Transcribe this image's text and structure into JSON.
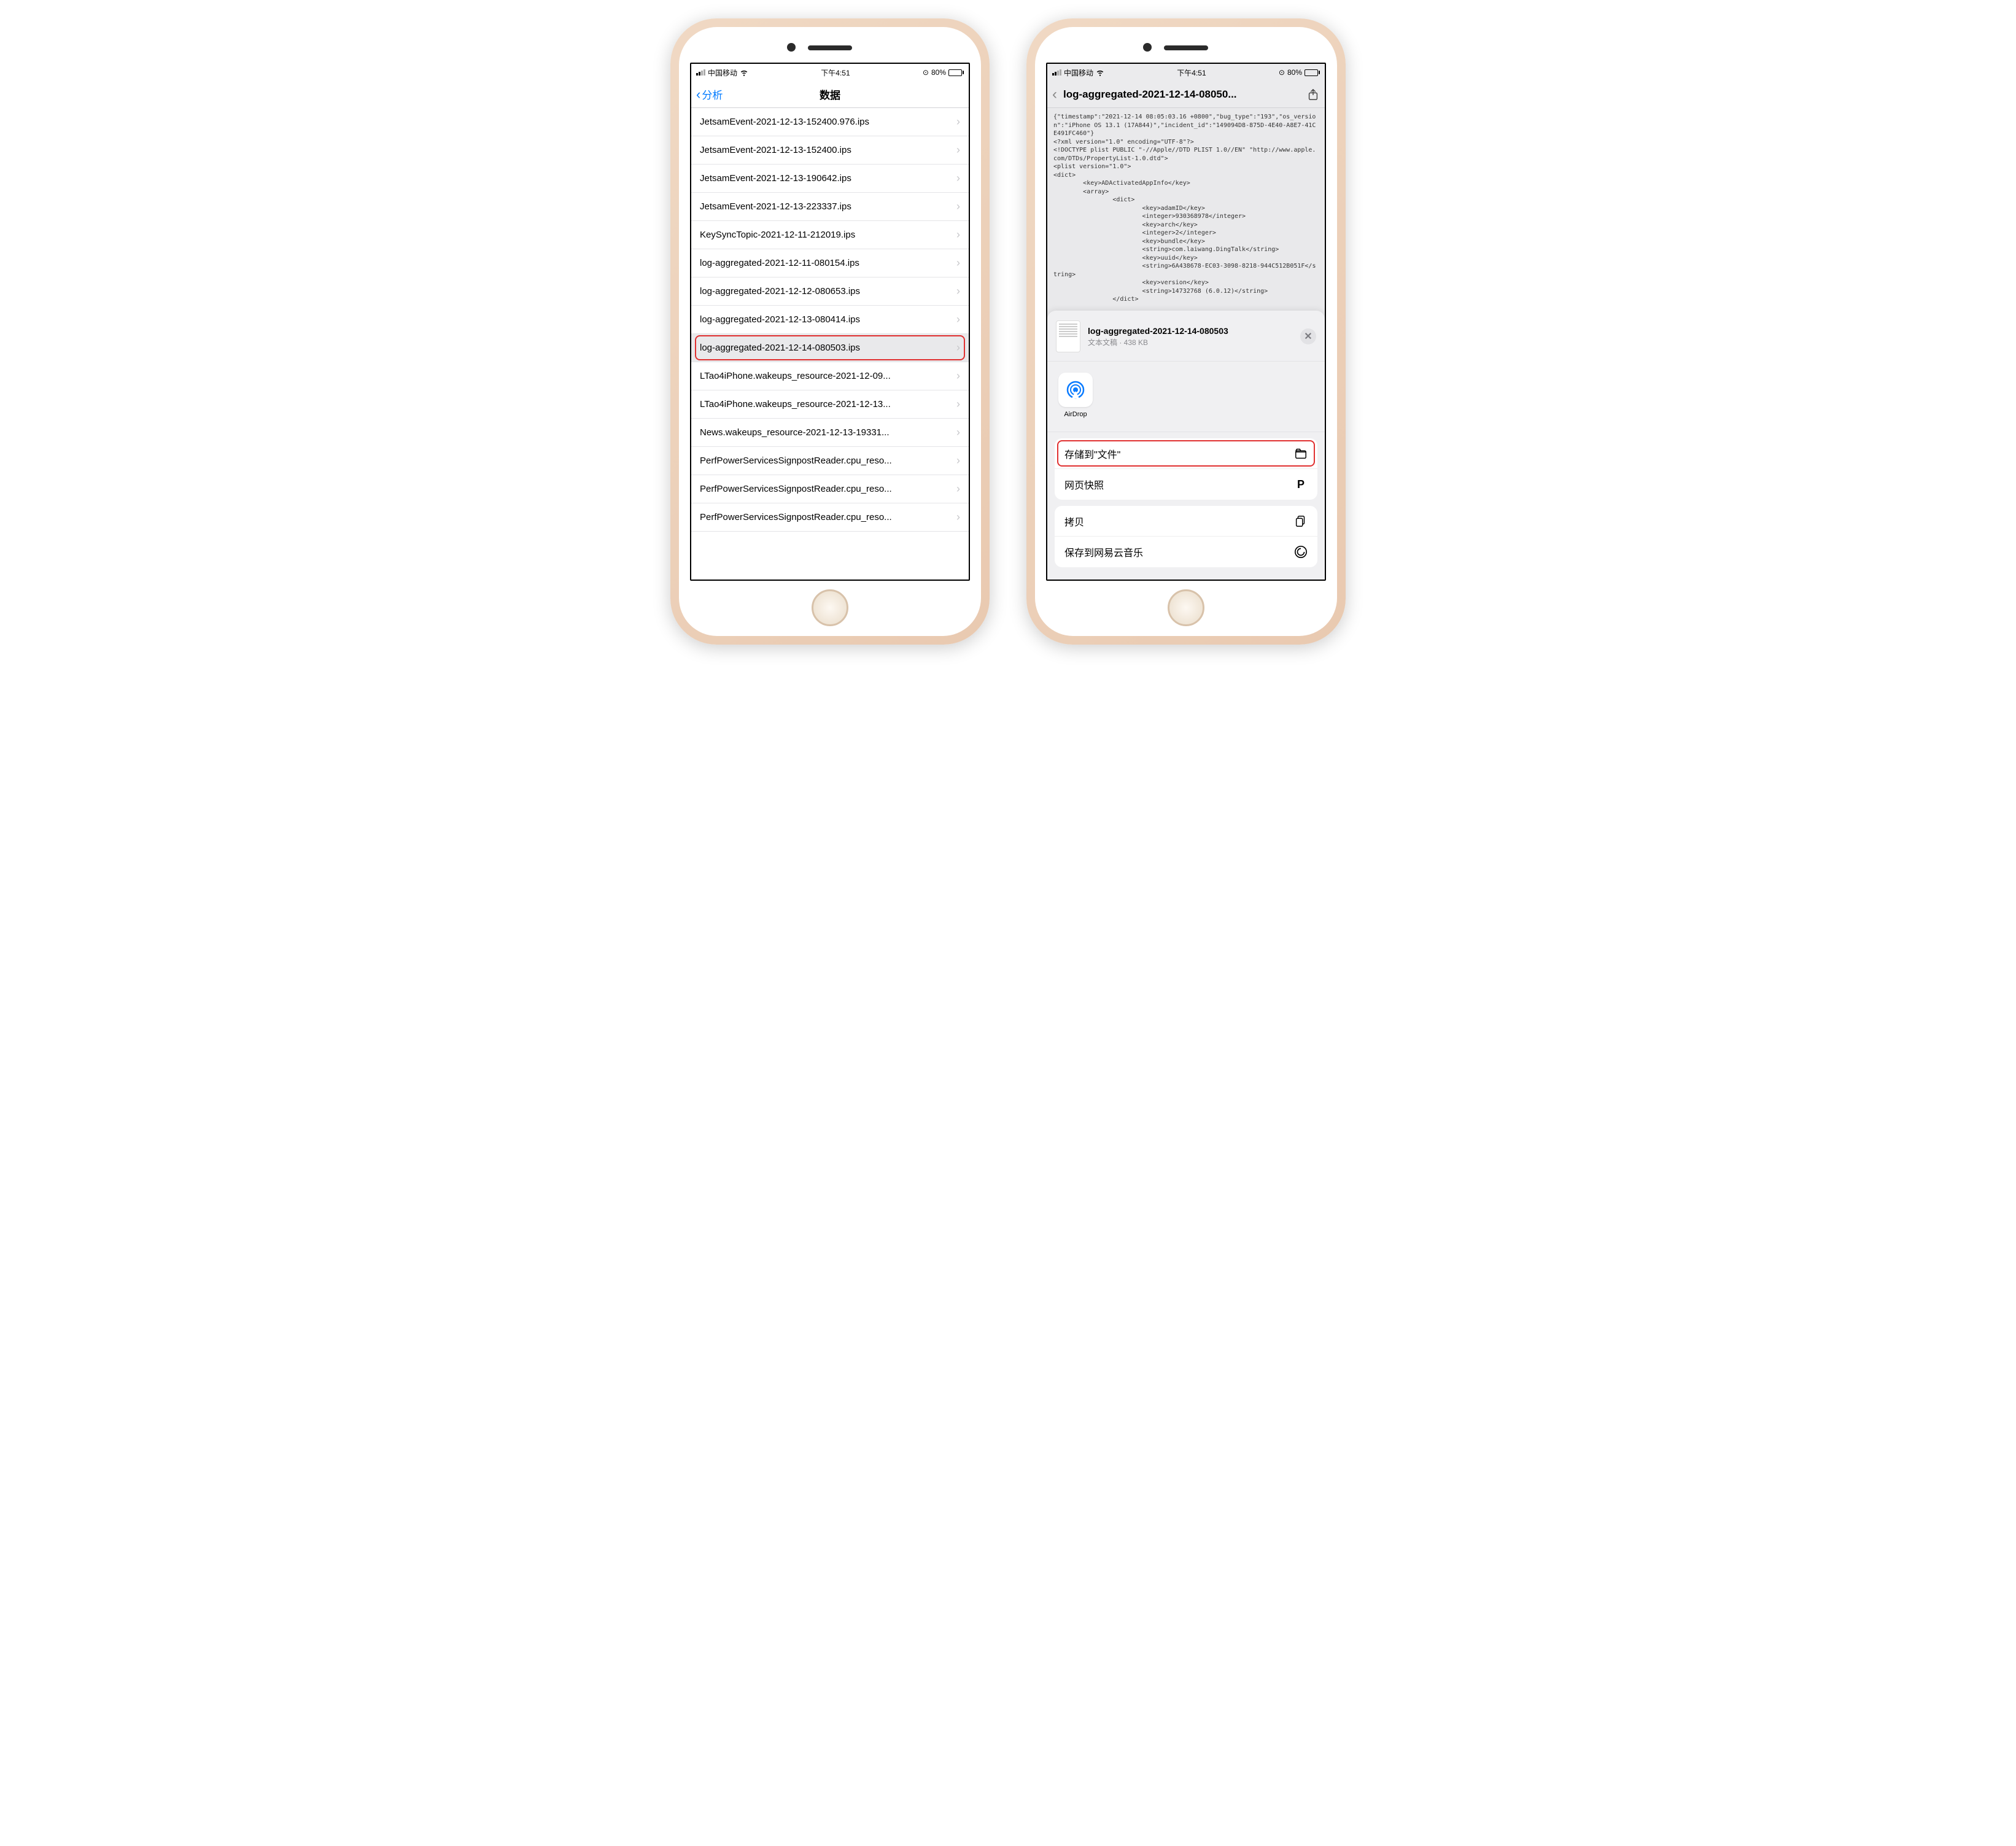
{
  "statusbar": {
    "carrier": "中国移动",
    "time": "下午4:51",
    "battery_pct": "80%"
  },
  "left": {
    "back_label": "分析",
    "title": "数据",
    "items": [
      "JetsamEvent-2021-12-13-152400.976.ips",
      "JetsamEvent-2021-12-13-152400.ips",
      "JetsamEvent-2021-12-13-190642.ips",
      "JetsamEvent-2021-12-13-223337.ips",
      "KeySyncTopic-2021-12-11-212019.ips",
      "log-aggregated-2021-12-11-080154.ips",
      "log-aggregated-2021-12-12-080653.ips",
      "log-aggregated-2021-12-13-080414.ips",
      "log-aggregated-2021-12-14-080503.ips",
      "LTao4iPhone.wakeups_resource-2021-12-09...",
      "LTao4iPhone.wakeups_resource-2021-12-13...",
      "News.wakeups_resource-2021-12-13-19331...",
      "PerfPowerServicesSignpostReader.cpu_reso...",
      "PerfPowerServicesSignpostReader.cpu_reso...",
      "PerfPowerServicesSignpostReader.cpu_reso..."
    ],
    "highlight_index": 8
  },
  "right": {
    "title": "log-aggregated-2021-12-14-08050...",
    "raw_text": "{\"timestamp\":\"2021-12-14 08:05:03.16 +0800\",\"bug_type\":\"193\",\"os_version\":\"iPhone OS 13.1 (17A844)\",\"incident_id\":\"149094D8-875D-4E40-A8E7-41CE491FC460\"}\n<?xml version=\"1.0\" encoding=\"UTF-8\"?>\n<!DOCTYPE plist PUBLIC \"-//Apple//DTD PLIST 1.0//EN\" \"http://www.apple.com/DTDs/PropertyList-1.0.dtd\">\n<plist version=\"1.0\">\n<dict>\n        <key>ADActivatedAppInfo</key>\n        <array>\n                <dict>\n                        <key>adamID</key>\n                        <integer>930368978</integer>\n                        <key>arch</key>\n                        <integer>2</integer>\n                        <key>bundle</key>\n                        <string>com.laiwang.DingTalk</string>\n                        <key>uuid</key>\n                        <string>6A438678-EC03-3098-8218-944C512B051F</string>\n                        <key>version</key>\n                        <string>14732768 (6.0.12)</string>\n                </dict>",
    "sheet": {
      "file_title": "log-aggregated-2021-12-14-080503",
      "file_sub": "文本文稿 · 438 KB",
      "airdrop_label": "AirDrop",
      "actions": {
        "save_to_files": "存储到\"文件\"",
        "web_snapshot": "网页快照",
        "copy": "拷贝",
        "save_to_netease": "保存到网易云音乐"
      }
    }
  }
}
